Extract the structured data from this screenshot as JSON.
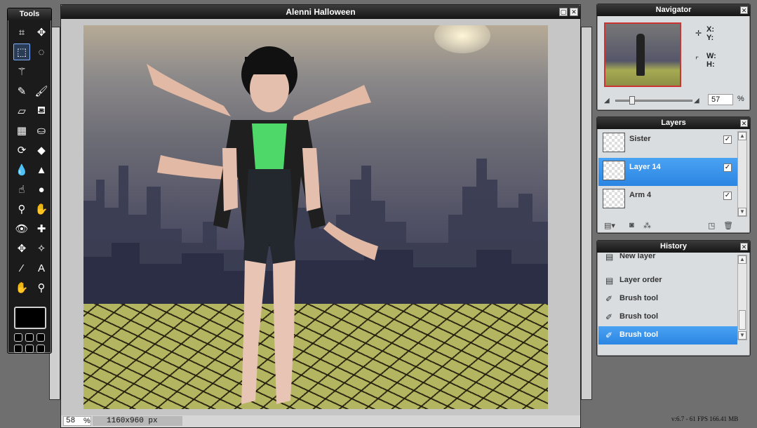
{
  "tools_panel": {
    "title": "Tools",
    "tools": [
      {
        "name": "crop-tool-icon",
        "glyph": "⌗"
      },
      {
        "name": "move-tool-icon",
        "glyph": "✥"
      },
      {
        "name": "marquee-tool-icon",
        "glyph": "⬚",
        "active": true
      },
      {
        "name": "lasso-tool-icon",
        "glyph": "◌"
      },
      {
        "name": "magic-wand-icon",
        "glyph": "⚚"
      },
      {
        "name": "empty-slot",
        "glyph": ""
      },
      {
        "name": "pencil-tool-icon",
        "glyph": "✎"
      },
      {
        "name": "brush-tool-icon",
        "glyph": "🖌"
      },
      {
        "name": "eraser-tool-icon",
        "glyph": "▱"
      },
      {
        "name": "bucket-tool-icon",
        "glyph": "⛾"
      },
      {
        "name": "gradient-tool-icon",
        "glyph": "▦"
      },
      {
        "name": "stamp-tool-icon",
        "glyph": "⛀"
      },
      {
        "name": "color-replace-icon",
        "glyph": "⟳"
      },
      {
        "name": "shape-tool-icon",
        "glyph": "◆"
      },
      {
        "name": "blur-tool-icon",
        "glyph": "💧"
      },
      {
        "name": "sharpen-tool-icon",
        "glyph": "▲"
      },
      {
        "name": "smudge-tool-icon",
        "glyph": "☝"
      },
      {
        "name": "sponge-tool-icon",
        "glyph": "●"
      },
      {
        "name": "dodge-tool-icon",
        "glyph": "⚲"
      },
      {
        "name": "burn-tool-icon",
        "glyph": "✋"
      },
      {
        "name": "red-eye-tool-icon",
        "glyph": "👁"
      },
      {
        "name": "spot-heal-icon",
        "glyph": "✚"
      },
      {
        "name": "bloat-tool-icon",
        "glyph": "✥"
      },
      {
        "name": "pinch-tool-icon",
        "glyph": "✧"
      },
      {
        "name": "color-picker-icon",
        "glyph": "⁄"
      },
      {
        "name": "type-tool-icon",
        "glyph": "A"
      },
      {
        "name": "hand-tool-icon",
        "glyph": "✋"
      },
      {
        "name": "zoom-tool-icon",
        "glyph": "⚲"
      }
    ]
  },
  "document": {
    "title": "Alenni Halloween",
    "zoom": "58",
    "zoom_unit": "%",
    "dimensions": "1160x960 px"
  },
  "navigator": {
    "title": "Navigator",
    "x_label": "X:",
    "y_label": "Y:",
    "w_label": "W:",
    "h_label": "H:",
    "zoom_value": "57",
    "zoom_unit": "%",
    "zoom_fraction": 0.2
  },
  "layers": {
    "title": "Layers",
    "items": [
      {
        "label": "Sister",
        "visible": true,
        "selected": false
      },
      {
        "label": "Layer 14",
        "visible": true,
        "selected": true
      },
      {
        "label": "Arm 4",
        "visible": true,
        "selected": false
      }
    ]
  },
  "history": {
    "title": "History",
    "items": [
      {
        "label": "New layer",
        "selected": false
      },
      {
        "label": "Layer order",
        "selected": false
      },
      {
        "label": "Brush tool",
        "selected": false
      },
      {
        "label": "Brush tool",
        "selected": false
      },
      {
        "label": "Brush tool",
        "selected": true
      }
    ]
  },
  "status": {
    "footer": "v:6.7 - 61 FPS 166.41 MB"
  },
  "colors": {
    "selection": "#2b86e3",
    "panel_bg": "#d9dde0",
    "titlebar": "#1a1a1a"
  }
}
